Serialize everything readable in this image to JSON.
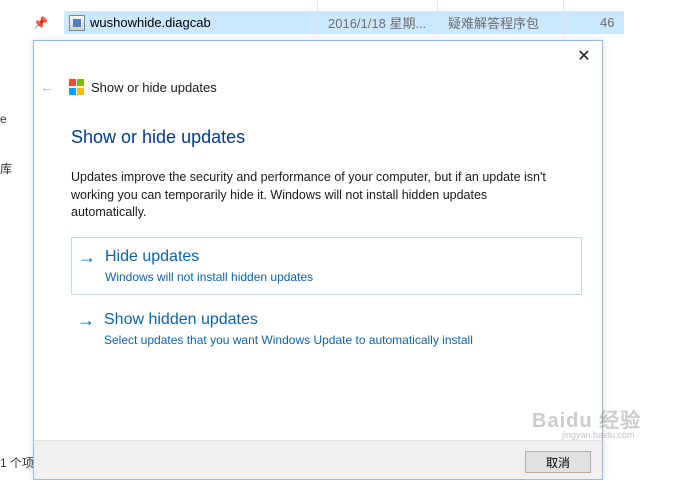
{
  "explorer": {
    "file": {
      "name": "wushowhide.diagcab",
      "date": "2016/1/18 星期...",
      "type": "疑难解答程序包",
      "size": "46"
    },
    "left_fragments": [
      "e",
      "库"
    ],
    "status": "1 个项"
  },
  "dialog": {
    "caption": "Show or hide updates",
    "heading": "Show or hide updates",
    "description": "Updates improve the security and performance of your computer, but if an update isn't working you can temporarily hide it. Windows will not install hidden updates automatically.",
    "options": [
      {
        "title": "Hide updates",
        "subtitle": "Windows will not install hidden updates"
      },
      {
        "title": "Show hidden updates",
        "subtitle": "Select updates that you want Windows Update to automatically install"
      }
    ],
    "cancel_label": "取消"
  },
  "watermark": {
    "text": "Baidu 经验",
    "sub": "jingyan.baidu.com"
  },
  "colors": {
    "heading": "#003b8e",
    "link": "#0a64ad",
    "selection": "#cce8ff",
    "logo": [
      "#f25022",
      "#7fba00",
      "#00a4ef",
      "#ffb900"
    ]
  },
  "icons": {
    "close": "close-icon",
    "back": "back-arrow-icon",
    "option_arrow": "right-arrow-icon",
    "logo": "windows-logo-icon"
  }
}
